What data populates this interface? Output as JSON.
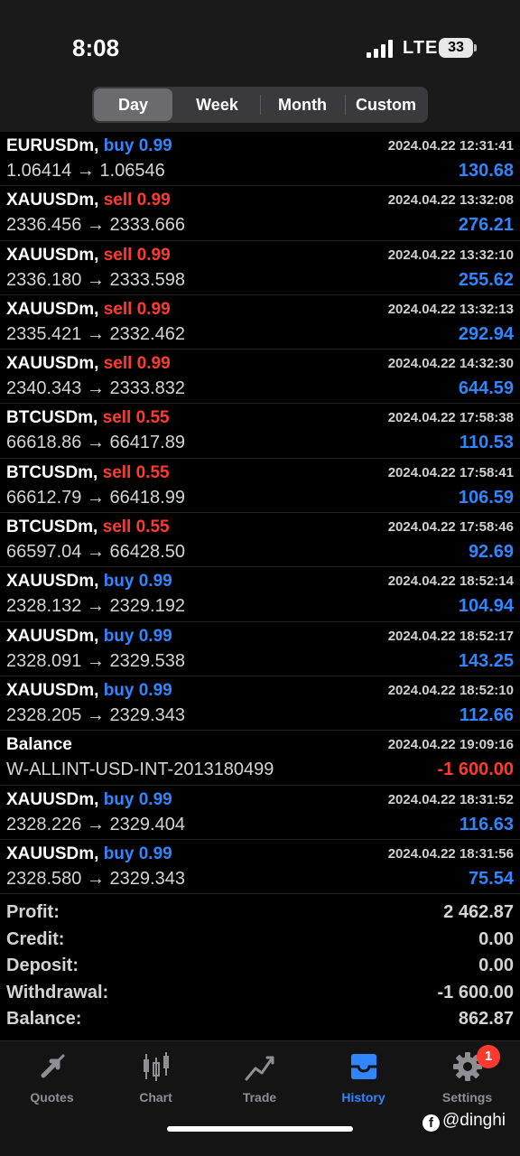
{
  "status": {
    "time": "8:08",
    "network": "LTE",
    "battery": "33"
  },
  "filter_tabs": [
    {
      "label": "Day",
      "active": true
    },
    {
      "label": "Week",
      "active": false
    },
    {
      "label": "Month",
      "active": false
    },
    {
      "label": "Custom",
      "active": false
    }
  ],
  "deals": [
    {
      "symbol": "EURUSDm,",
      "side": "buy 0.99",
      "type": "buy",
      "prices": "1.06414 → 1.06546",
      "time": "2024.04.22 12:31:41",
      "amount": "130.68",
      "sign": "pos"
    },
    {
      "symbol": "XAUUSDm,",
      "side": "sell 0.99",
      "type": "sell",
      "prices": "2336.456 → 2333.666",
      "time": "2024.04.22 13:32:08",
      "amount": "276.21",
      "sign": "pos"
    },
    {
      "symbol": "XAUUSDm,",
      "side": "sell 0.99",
      "type": "sell",
      "prices": "2336.180 → 2333.598",
      "time": "2024.04.22 13:32:10",
      "amount": "255.62",
      "sign": "pos"
    },
    {
      "symbol": "XAUUSDm,",
      "side": "sell 0.99",
      "type": "sell",
      "prices": "2335.421 → 2332.462",
      "time": "2024.04.22 13:32:13",
      "amount": "292.94",
      "sign": "pos"
    },
    {
      "symbol": "XAUUSDm,",
      "side": "sell 0.99",
      "type": "sell",
      "prices": "2340.343 → 2333.832",
      "time": "2024.04.22 14:32:30",
      "amount": "644.59",
      "sign": "pos"
    },
    {
      "symbol": "BTCUSDm,",
      "side": "sell 0.55",
      "type": "sell",
      "prices": "66618.86 → 66417.89",
      "time": "2024.04.22 17:58:38",
      "amount": "110.53",
      "sign": "pos"
    },
    {
      "symbol": "BTCUSDm,",
      "side": "sell 0.55",
      "type": "sell",
      "prices": "66612.79 → 66418.99",
      "time": "2024.04.22 17:58:41",
      "amount": "106.59",
      "sign": "pos"
    },
    {
      "symbol": "BTCUSDm,",
      "side": "sell 0.55",
      "type": "sell",
      "prices": "66597.04 → 66428.50",
      "time": "2024.04.22 17:58:46",
      "amount": "92.69",
      "sign": "pos"
    },
    {
      "symbol": "XAUUSDm,",
      "side": "buy 0.99",
      "type": "buy",
      "prices": "2328.132 → 2329.192",
      "time": "2024.04.22 18:52:14",
      "amount": "104.94",
      "sign": "pos"
    },
    {
      "symbol": "XAUUSDm,",
      "side": "buy 0.99",
      "type": "buy",
      "prices": "2328.091 → 2329.538",
      "time": "2024.04.22 18:52:17",
      "amount": "143.25",
      "sign": "pos"
    },
    {
      "symbol": "XAUUSDm,",
      "side": "buy 0.99",
      "type": "buy",
      "prices": "2328.205 → 2329.343",
      "time": "2024.04.22 18:52:10",
      "amount": "112.66",
      "sign": "pos"
    },
    {
      "symbol": "Balance",
      "side": "",
      "type": "",
      "prices": "W-ALLINT-USD-INT-2013180499",
      "time": "2024.04.22 19:09:16",
      "amount": "-1 600.00",
      "sign": "neg"
    },
    {
      "symbol": "XAUUSDm,",
      "side": "buy 0.99",
      "type": "buy",
      "prices": "2328.226 → 2329.404",
      "time": "2024.04.22 18:31:52",
      "amount": "116.63",
      "sign": "pos"
    },
    {
      "symbol": "XAUUSDm,",
      "side": "buy 0.99",
      "type": "buy",
      "prices": "2328.580 → 2329.343",
      "time": "2024.04.22 18:31:56",
      "amount": "75.54",
      "sign": "pos"
    }
  ],
  "summary": [
    {
      "label": "Profit:",
      "value": "2 462.87"
    },
    {
      "label": "Credit:",
      "value": "0.00"
    },
    {
      "label": "Deposit:",
      "value": "0.00"
    },
    {
      "label": "Withdrawal:",
      "value": "-1 600.00"
    },
    {
      "label": "Balance:",
      "value": "862.87"
    }
  ],
  "tabbar": [
    {
      "label": "Quotes",
      "icon": "quotes-arrows-icon",
      "active": false
    },
    {
      "label": "Chart",
      "icon": "candlestick-icon",
      "active": false
    },
    {
      "label": "Trade",
      "icon": "trend-line-icon",
      "active": false
    },
    {
      "label": "History",
      "icon": "inbox-tray-icon",
      "active": true
    },
    {
      "label": "Settings",
      "icon": "gear-icon",
      "active": false
    }
  ],
  "settings_badge": "1",
  "watermark": "@dinghi",
  "colors": {
    "buy": "#2f86ff",
    "sell": "#ff3b30",
    "active_tab": "#2f86ff",
    "inactive_tab": "#8e8e93"
  }
}
